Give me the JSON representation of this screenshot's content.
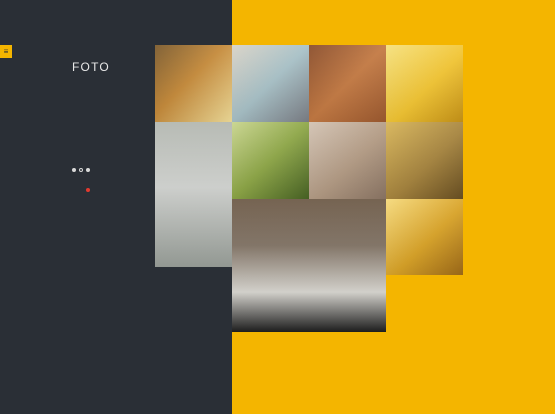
{
  "app": {
    "title": "FOTO",
    "menu_label": "≡",
    "description": "",
    "caption": ""
  },
  "gallery": {
    "tiles": [
      {
        "name": "tile-bike-sunset",
        "color": "#b07a2f"
      },
      {
        "name": "tile-woman-hat",
        "color": "#b4b0a7"
      },
      {
        "name": "tile-chairs-brick",
        "color": "#b36c3a"
      },
      {
        "name": "tile-yellow-chair",
        "color": "#e5c03c"
      },
      {
        "name": "tile-cup-table",
        "color": "#9a9c97"
      },
      {
        "name": "tile-grass",
        "color": "#8c9f4a"
      },
      {
        "name": "tile-table-corner",
        "color": "#b69f86"
      },
      {
        "name": "tile-golden-grass",
        "color": "#a8843b"
      },
      {
        "name": "tile-cafe-interior",
        "color": "#6a5b4b"
      },
      {
        "name": "tile-yellow-table",
        "color": "#d8a622"
      }
    ]
  },
  "colors": {
    "left_panel": "#2a2f36",
    "right_panel": "#f4b500",
    "accent_dot": "#e23a2f"
  }
}
